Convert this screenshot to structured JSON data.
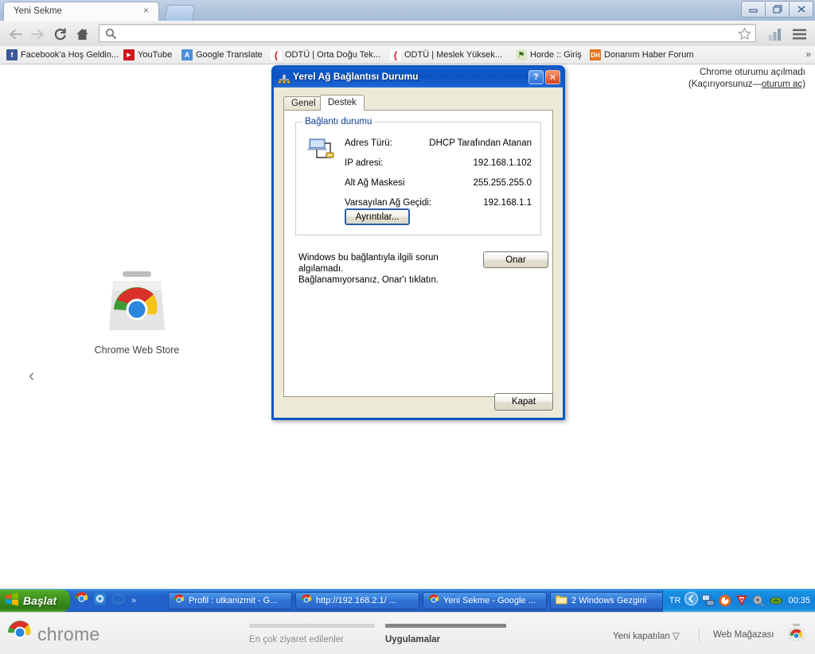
{
  "browser": {
    "tab": {
      "title": "Yeni Sekme",
      "close_label": "×"
    },
    "newtab_button": "new-tab",
    "window_controls": {
      "minimize": "minimize-icon",
      "maximize": "maximize-icon",
      "close": "close-icon"
    },
    "nav": {
      "back": "back-arrow-icon",
      "forward": "forward-arrow-icon",
      "reload": "reload-icon",
      "home": "home-icon"
    },
    "omnibox": {
      "value": "",
      "placeholder": "",
      "search_icon": "search-icon",
      "star_icon": "star-icon"
    },
    "toolbar_right": {
      "signal_icon": "signal-bars-icon",
      "menu_icon": "hamburger-menu-icon"
    },
    "bookmarks": [
      {
        "label": "Facebook'a Hoş Geldin...",
        "favicon": "f",
        "color": "#3b5998"
      },
      {
        "label": "YouTube",
        "favicon": "▶",
        "color": "#cc181e"
      },
      {
        "label": "Google Translate",
        "favicon": "A",
        "color": "#4a90d9"
      },
      {
        "label": "ODTÜ | Orta Doğu Tek...",
        "favicon": "(",
        "color": "#d42128"
      },
      {
        "label": "ODTÜ | Meslek Yüksek...",
        "favicon": "(",
        "color": "#d42128"
      },
      {
        "label": "Horde :: Giriş",
        "favicon": "⚑",
        "color": "#7aa83c"
      },
      {
        "label": "Donanım Haber Forum",
        "favicon": "DH",
        "color": "#e2761b"
      }
    ],
    "bookmarks_overflow": "»"
  },
  "newtab_page": {
    "signin_line1": "Chrome oturumu açılmadı",
    "signin_line2_prefix": "(Kaçırıyorsunuz—",
    "signin_link": "oturum aç",
    "signin_line2_suffix": ")",
    "tile_label": "Chrome Web Store",
    "tile_icon": "chrome-web-store-icon",
    "prev_arrow": "‹",
    "brand": "chrome",
    "brand_icon": "chrome-logo-icon",
    "sections": [
      {
        "label": "En çok ziyaret edilenler",
        "active": false
      },
      {
        "label": "Uygulamalar",
        "active": true
      }
    ],
    "recently_closed": "Yeni kapatılan",
    "recently_closed_caret": "▽",
    "web_store": "Web Mağazası",
    "web_store_icon": "chrome-web-store-icon"
  },
  "dialog": {
    "title": "Yerel Ağ Bağlantısı Durumu",
    "title_icon": "network-connection-icon",
    "help_button": "?",
    "close_button": "✕",
    "tabs": [
      {
        "label": "Genel",
        "active": false
      },
      {
        "label": "Destek",
        "active": true
      }
    ],
    "group_legend": "Bağlantı durumu",
    "status_icon": "computer-network-icon",
    "fields": [
      {
        "key": "Adres Türü:",
        "value": "DHCP Tarafından Atanan"
      },
      {
        "key": "IP adresi:",
        "value": "192.168.1.102"
      },
      {
        "key": "Alt Ağ Maskesi",
        "value": "255.255.255.0"
      },
      {
        "key": "Varsayılan Ağ Geçidi:",
        "value": "192.168.1.1"
      }
    ],
    "details_button": "Ayrıntılar...",
    "repair_text_line1": "Windows bu bağlantıyla ilgili sorun algılamadı.",
    "repair_text_line2": "Bağlanamıyorsanız, Onar'ı tıklatın.",
    "repair_button": "Onar",
    "close_action_button": "Kapat"
  },
  "taskbar": {
    "start_label": "Başlat",
    "start_icon": "windows-flag-icon",
    "quicklaunch": [
      {
        "name": "chrome-icon"
      },
      {
        "name": "media-player-icon"
      },
      {
        "name": "internet-explorer-icon"
      }
    ],
    "quicklaunch_overflow": "»",
    "tasks": [
      {
        "label": "Profil : utkanizmit - G...",
        "icon": "chrome-icon",
        "has_caret": false
      },
      {
        "label": "http://192.168.2.1/ ...",
        "icon": "chrome-icon",
        "has_caret": false
      },
      {
        "label": "Yeni Sekme - Google ...",
        "icon": "chrome-icon",
        "has_caret": false
      },
      {
        "label": "2 Windows Gezgini",
        "icon": "folder-icon",
        "has_caret": true
      }
    ],
    "language": "TR",
    "tray_toggle": "‹",
    "tray_icons": [
      {
        "name": "network-connections-icon"
      },
      {
        "name": "antivirus-shield-icon"
      },
      {
        "name": "avast-icon"
      },
      {
        "name": "volume-icon"
      },
      {
        "name": "nvidia-icon"
      }
    ],
    "clock": "00:35"
  },
  "colors": {
    "xp_blue": "#0a57c2",
    "xp_face": "#ece9d8",
    "taskbar_blue": "#2464cd",
    "start_green": "#3b8f1c",
    "legend_blue": "#0b3d91"
  }
}
